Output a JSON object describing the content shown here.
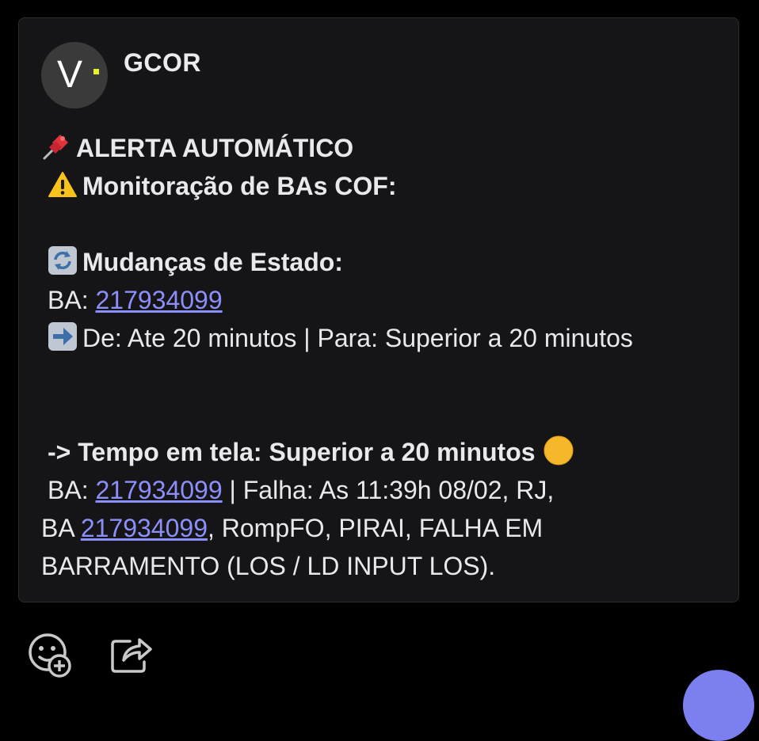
{
  "message": {
    "sender": "GCOR",
    "avatar_letter": "V",
    "lines": {
      "alert_title": "ALERTA AUTOMÁTICO",
      "monitor_title": "Monitoração de BAs COF:",
      "changes_title": "Mudanças de Estado:",
      "ba_label": "BA: ",
      "ba_number": "217934099",
      "transition_text": "De: Ate 20 minutos | Para: Superior a 20 minutos",
      "time_title": "-> Tempo em tela: Superior a 20 minutos",
      "fault_prefix": "BA: ",
      "fault_ba": "217934099",
      "fault_text": " | Falha: As 11:39h 08/02, RJ,",
      "detail_prefix": "BA ",
      "detail_ba": "217934099",
      "detail_text": ", RompFO, PIRAI, FALHA EM",
      "detail_text2": "BARRAMENTO (LOS / LD INPUT LOS)."
    },
    "icons": {
      "pin": "pushpin-icon",
      "warning": "warning-icon",
      "refresh": "arrows-counterclockwise-icon",
      "arrow": "right-arrow-icon",
      "circle": "yellow-circle-icon"
    }
  },
  "actions": {
    "react": "add-reaction-icon",
    "share": "share-icon"
  },
  "colors": {
    "background": "#000000",
    "card": "#151517",
    "link": "#8b8ffa",
    "avatar_dot": "#e7f02c",
    "fab": "#7b7ff0"
  }
}
